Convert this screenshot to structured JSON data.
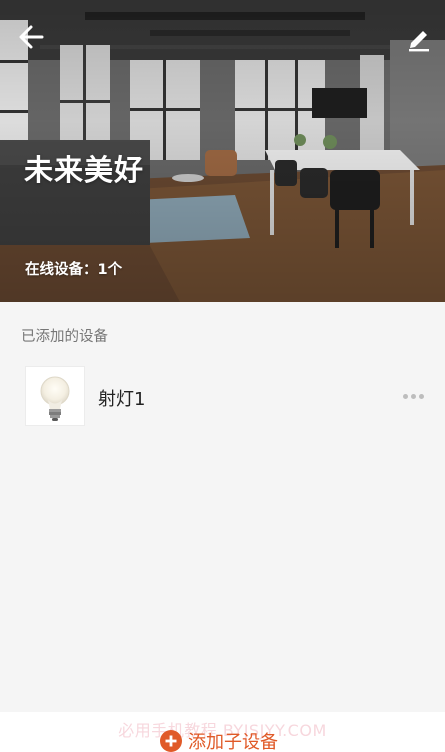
{
  "hero": {
    "title": "未来美好",
    "online_status": "在线设备：1个",
    "back_icon": "arrow-left-icon",
    "edit_icon": "pencil-icon"
  },
  "devices_section": {
    "label": "已添加的设备",
    "items": [
      {
        "name": "射灯1",
        "icon": "light-bulb-icon",
        "menu_icon": "more-dots-icon"
      }
    ]
  },
  "footer": {
    "add_label": "添加子设备",
    "add_icon": "plus-circle-icon",
    "watermark": "必用手机教程 BYJSJYY.COM"
  },
  "colors": {
    "accent": "#e05a28",
    "background": "#f5f5f5",
    "title_text": "#ffffff"
  }
}
